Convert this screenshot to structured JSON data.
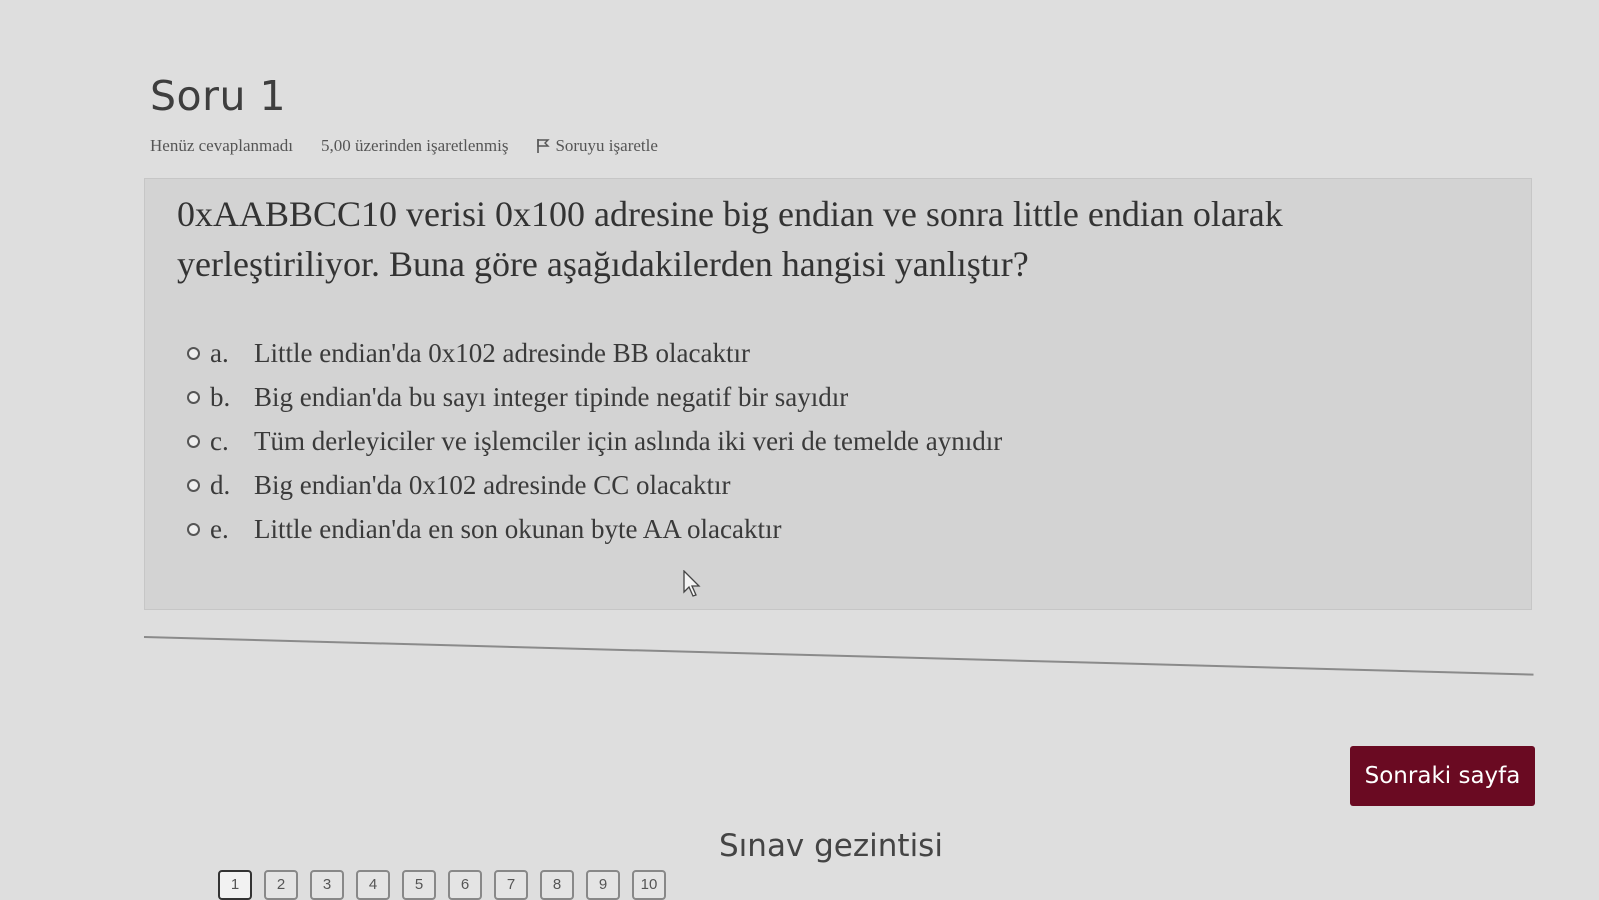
{
  "question": {
    "title": "Soru 1",
    "status": "Henüz cevaplanmadı",
    "marks": "5,00 üzerinden işaretlenmiş",
    "flag_label": "Soruyu işaretle",
    "text": "0xAABBCC10 verisi 0x100 adresine big endian ve sonra little endian olarak yerleştiriliyor. Buna göre aşağıdakilerden hangisi yanlıştır?",
    "answers": [
      {
        "letter": "a.",
        "text": "Little endian'da 0x102 adresinde BB olacaktır"
      },
      {
        "letter": "b.",
        "text": "Big endian'da bu sayı integer tipinde negatif bir sayıdır"
      },
      {
        "letter": "c.",
        "text": "Tüm derleyiciler ve işlemciler için aslında iki veri de temelde aynıdır"
      },
      {
        "letter": "d.",
        "text": "Big endian'da 0x102 adresinde CC olacaktır"
      },
      {
        "letter": "e.",
        "text": "Little endian'da en son okunan byte AA olacaktır"
      }
    ]
  },
  "next_button": "Sonraki sayfa",
  "navigation": {
    "title": "Sınav gezintisi",
    "pages": [
      "1",
      "2",
      "3",
      "4",
      "5",
      "6",
      "7",
      "8",
      "9",
      "10"
    ],
    "current": "1"
  },
  "colors": {
    "accent": "#6a0a22",
    "background": "#dedede",
    "question_box": "#d3d3d3"
  }
}
